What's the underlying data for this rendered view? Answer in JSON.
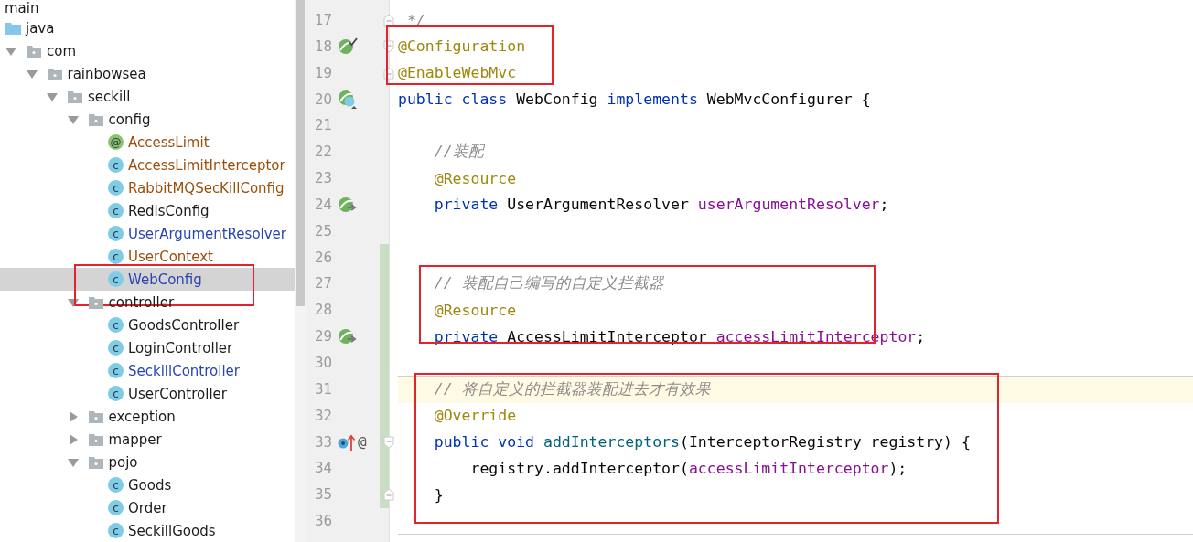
{
  "project_tree": {
    "items": [
      {
        "name": "main",
        "kind": "folder-label",
        "selected": false
      },
      {
        "name": "java",
        "kind": "source-root",
        "selected": false
      },
      {
        "name": "com",
        "kind": "package",
        "expanded": true,
        "selected": false,
        "children": [
          {
            "name": "rainbowsea",
            "kind": "package",
            "expanded": true,
            "selected": false,
            "children": [
              {
                "name": "seckill",
                "kind": "package",
                "expanded": true,
                "selected": false,
                "children": [
                  {
                    "name": "config",
                    "kind": "package",
                    "expanded": true,
                    "selected": false,
                    "children": [
                      {
                        "name": "AccessLimit",
                        "kind": "annotation",
                        "badge": "@",
                        "color": "#9c4f0c",
                        "selected": false
                      },
                      {
                        "name": "AccessLimitInterceptor",
                        "kind": "class",
                        "badge": "c",
                        "color": "#9c4f0c",
                        "selected": false
                      },
                      {
                        "name": "RabbitMQSecKillConfig",
                        "kind": "class",
                        "badge": "c",
                        "color": "#9c4f0c",
                        "selected": false
                      },
                      {
                        "name": "RedisConfig",
                        "kind": "class",
                        "badge": "c",
                        "selected": false
                      },
                      {
                        "name": "UserArgumentResolver",
                        "kind": "class",
                        "badge": "c",
                        "color": "#2a45b0",
                        "selected": false
                      },
                      {
                        "name": "UserContext",
                        "kind": "class",
                        "badge": "c",
                        "color": "#9c4f0c",
                        "selected": false
                      },
                      {
                        "name": "WebConfig",
                        "kind": "class",
                        "badge": "c",
                        "color": "#2a45b0",
                        "selected": true,
                        "annotated": true
                      }
                    ]
                  },
                  {
                    "name": "controller",
                    "kind": "package",
                    "expanded": true,
                    "selected": false,
                    "children": [
                      {
                        "name": "GoodsController",
                        "kind": "class",
                        "badge": "c",
                        "selected": false
                      },
                      {
                        "name": "LoginController",
                        "kind": "class",
                        "badge": "c",
                        "selected": false
                      },
                      {
                        "name": "SeckillController",
                        "kind": "class",
                        "badge": "c",
                        "color": "#2a45b0",
                        "selected": false
                      },
                      {
                        "name": "UserController",
                        "kind": "class",
                        "badge": "c",
                        "selected": false
                      }
                    ]
                  },
                  {
                    "name": "exception",
                    "kind": "package",
                    "expanded": false,
                    "selected": false
                  },
                  {
                    "name": "mapper",
                    "kind": "package",
                    "expanded": false,
                    "selected": false
                  },
                  {
                    "name": "pojo",
                    "kind": "package",
                    "expanded": true,
                    "selected": false,
                    "children": [
                      {
                        "name": "Goods",
                        "kind": "class",
                        "badge": "c",
                        "selected": false
                      },
                      {
                        "name": "Order",
                        "kind": "class",
                        "badge": "c",
                        "selected": false
                      },
                      {
                        "name": "SeckillGoods",
                        "kind": "class",
                        "badge": "c",
                        "selected": false
                      }
                    ]
                  }
                ]
              }
            ]
          }
        ]
      }
    ]
  },
  "editor": {
    "blocks": [
      {
        "annotated": false,
        "lines": [
          {
            "number": "17",
            "fold": {
              "kind": "end"
            },
            "tokens": [
              {
                "t": " */",
                "kind": "comment"
              }
            ]
          }
        ]
      },
      {
        "annotated": true,
        "lines": [
          {
            "number": "18",
            "fold": {
              "kind": "start"
            },
            "gutter": [
              {
                "kind": "bean-check"
              }
            ],
            "tokens": [
              {
                "t": "@Configuration",
                "kind": "annotation"
              }
            ]
          },
          {
            "number": "19",
            "fold": {
              "kind": "end"
            },
            "tokens": [
              {
                "t": "@EnableWebMvc",
                "kind": "annotation"
              }
            ]
          }
        ]
      },
      {
        "annotated": false,
        "lines": [
          {
            "number": "20",
            "gutter": [
              {
                "kind": "bean-class"
              }
            ],
            "tokens": [
              {
                "t": "public class ",
                "kind": "keyword"
              },
              {
                "t": "WebConfig ",
                "kind": "plain"
              },
              {
                "t": "implements ",
                "kind": "keyword"
              },
              {
                "t": "WebMvcConfigurer {",
                "kind": "plain"
              }
            ]
          },
          {
            "number": "21"
          },
          {
            "number": "22",
            "tokens": [
              {
                "t": "    //装配",
                "kind": "comment"
              }
            ]
          },
          {
            "number": "23",
            "tokens": [
              {
                "t": "    @Resource",
                "kind": "annotation"
              }
            ]
          },
          {
            "number": "24",
            "gutter": [
              {
                "kind": "bean-arrow"
              }
            ],
            "tokens": [
              {
                "t": "    private ",
                "kind": "keyword"
              },
              {
                "t": "UserArgumentResolver ",
                "kind": "plain"
              },
              {
                "t": "userArgumentResolver",
                "kind": "field"
              },
              {
                "t": ";",
                "kind": "plain"
              }
            ]
          },
          {
            "number": "25"
          },
          {
            "number": "26",
            "changed": true
          }
        ]
      },
      {
        "annotated": true,
        "lines": [
          {
            "number": "27",
            "changed": true,
            "tokens": [
              {
                "t": "    // 装配自己编写的自定义拦截器",
                "kind": "comment"
              }
            ]
          },
          {
            "number": "28",
            "changed": true,
            "tokens": [
              {
                "t": "    @Resource",
                "kind": "annotation"
              }
            ]
          },
          {
            "number": "29",
            "changed": true,
            "gutter": [
              {
                "kind": "bean-arrow"
              }
            ],
            "tokens": [
              {
                "t": "    private ",
                "kind": "keyword"
              },
              {
                "t": "AccessLimitInterceptor ",
                "kind": "plain"
              },
              {
                "t": "accessLimitInterceptor",
                "kind": "field"
              },
              {
                "t": ";",
                "kind": "plain"
              }
            ]
          }
        ]
      },
      {
        "annotated": false,
        "lines": [
          {
            "number": "30",
            "changed": true
          }
        ]
      },
      {
        "annotated": true,
        "lines": [
          {
            "number": "31",
            "changed": true,
            "current": true,
            "separator_above": true,
            "tokens": [
              {
                "t": "    // 将自定义的拦截器装配进去才有效果",
                "kind": "comment"
              }
            ]
          },
          {
            "number": "32",
            "changed": true,
            "tokens": [
              {
                "t": "    @Override",
                "kind": "annotation"
              }
            ]
          },
          {
            "number": "33",
            "changed": true,
            "fold": {
              "kind": "start"
            },
            "gutter": [
              {
                "kind": "implements-up"
              }
            ],
            "gutter_text": "@",
            "tokens": [
              {
                "t": "    public void ",
                "kind": "keyword"
              },
              {
                "t": "addInterceptors",
                "kind": "method"
              },
              {
                "t": "(InterceptorRegistry registry) {",
                "kind": "plain"
              }
            ]
          },
          {
            "number": "34",
            "changed": true,
            "tokens": [
              {
                "t": "        registry.addInterceptor(",
                "kind": "plain"
              },
              {
                "t": "accessLimitInterceptor",
                "kind": "field"
              },
              {
                "t": ");",
                "kind": "plain"
              }
            ]
          },
          {
            "number": "35",
            "changed": true,
            "fold": {
              "kind": "end"
            },
            "tokens": [
              {
                "t": "    }",
                "kind": "plain"
              }
            ]
          }
        ]
      },
      {
        "annotated": false,
        "lines": [
          {
            "number": "36",
            "separator_below": true
          }
        ]
      }
    ]
  }
}
